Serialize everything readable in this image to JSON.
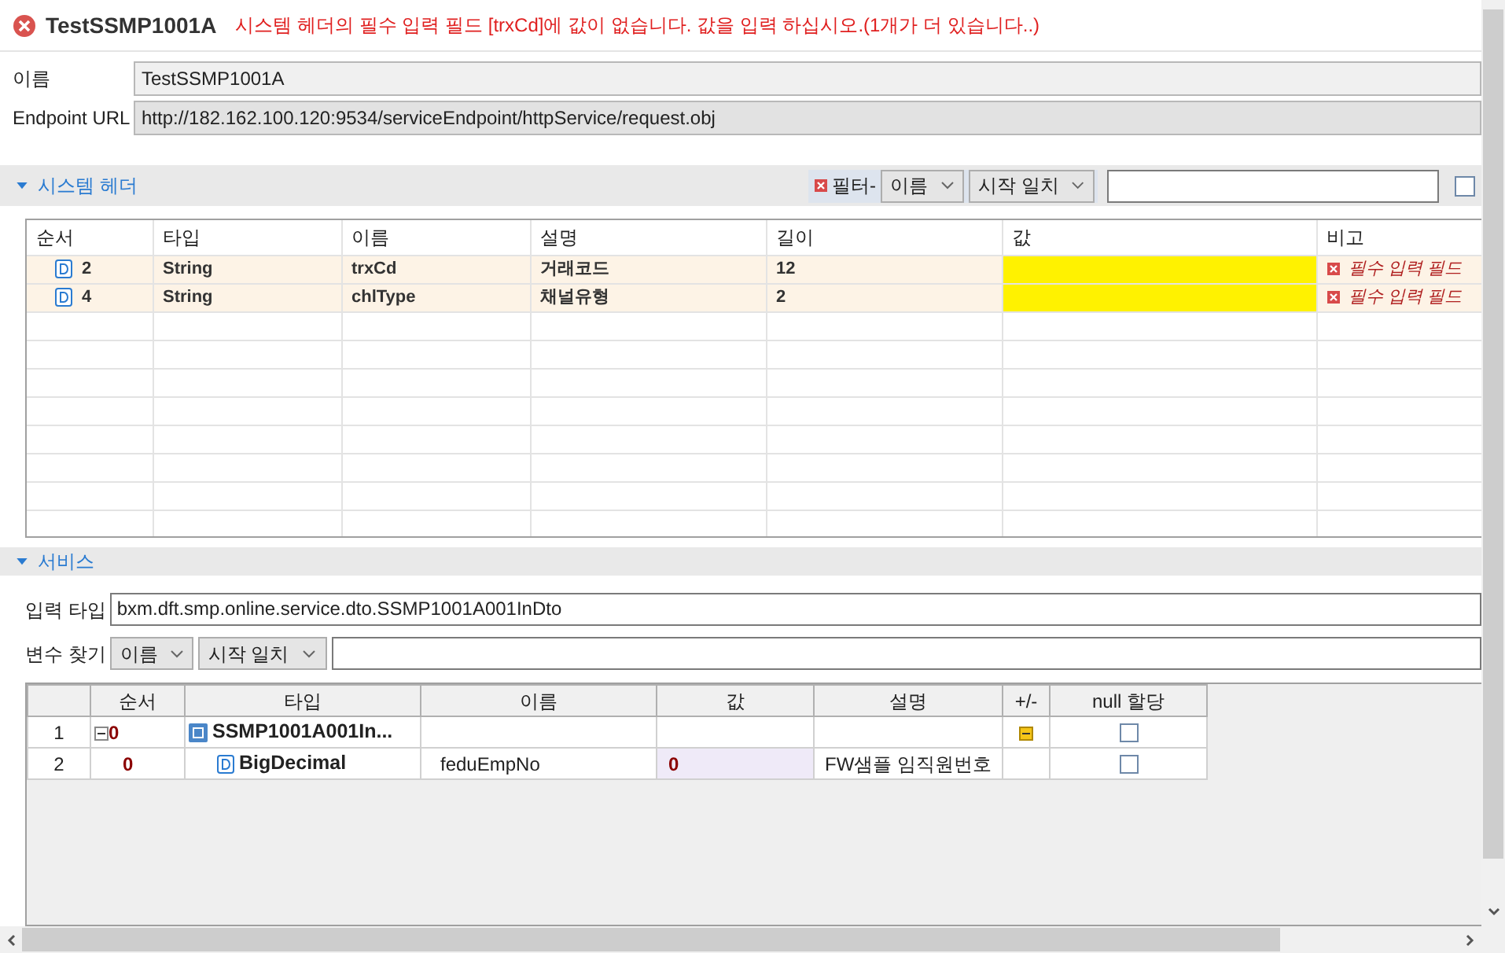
{
  "title": "TestSSMP1001A",
  "error_message": "시스템 헤더의 필수 입력 필드 [trxCd]에 값이 없습니다. 값을 입력 하십시오.(1개가 더 있습니다..)",
  "fields": [
    {
      "label": "이름",
      "value": "TestSSMP1001A"
    },
    {
      "label": "Endpoint URL",
      "value": "http://182.162.100.120:9534/serviceEndpoint/httpService/request.obj"
    }
  ],
  "system_header": {
    "title": "시스템 헤더",
    "expanded": true,
    "filter": {
      "label": "필터-",
      "field": "이름",
      "match": "시작 일치",
      "checked": false
    },
    "columns": [
      "순서",
      "타입",
      "이름",
      "설명",
      "길이",
      "값",
      "비고"
    ],
    "rows": [
      {
        "order": "2",
        "type": "String",
        "name": "trxCd",
        "description": "거래코드",
        "length": "12",
        "missing": true,
        "remark": "필수 입력 필드"
      },
      {
        "order": "4",
        "type": "String",
        "name": "chlType",
        "description": "채널유형",
        "length": "2",
        "missing": true,
        "remark": "필수 입력 필드"
      }
    ]
  },
  "service": {
    "title": "서비스",
    "expanded": true,
    "input_type": {
      "label": "입력 타입",
      "value": "bxm.dft.smp.online.service.dto.SSMP1001A001InDto"
    },
    "search": {
      "label": "변수 찾기",
      "field": "이름",
      "match": "시작 일치"
    },
    "columns": [
      "순서",
      "타입",
      "이름",
      "값",
      "설명",
      "+/-",
      "null 할당"
    ],
    "rows": [
      {
        "row": "1",
        "order": "0",
        "type": "SSMP1001A001In...",
        "expanded": true,
        "null_assigned": false,
        "children": [
          {
            "row": "2",
            "order": "0",
            "type": "BigDecimal",
            "name": "feduEmpNo",
            "value": "0",
            "description": "FW샘플 임직원번호",
            "null_assigned": false
          }
        ]
      }
    ]
  }
}
